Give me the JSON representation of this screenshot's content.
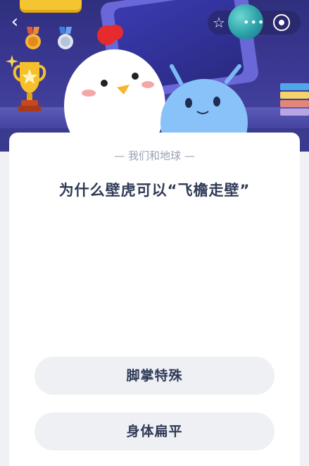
{
  "header": {
    "back_icon": "chevron-left-icon",
    "badges": [
      "bronze-medal-icon",
      "silver-medal-icon"
    ],
    "trophy_icon": "trophy-icon",
    "characters": [
      "chicken-mascot",
      "blue-alien-mascot"
    ],
    "capsule": {
      "favorite_icon": "star-outline-icon",
      "more_icon": "more-dots-icon",
      "close_icon": "target-close-icon"
    }
  },
  "card": {
    "category": "— 我们和地球 —",
    "question": "为什么壁虎可以“飞檐走壁”",
    "options": [
      {
        "label": "脚掌特殊"
      },
      {
        "label": "身体扁平"
      }
    ]
  },
  "colors": {
    "scene_top": "#2f2f7e",
    "scene_bottom": "#4b49a6",
    "card_bg": "#ffffff",
    "question_text": "#2f3a57",
    "option_bg": "#eef0f4",
    "category_text": "#9aa1b3"
  }
}
